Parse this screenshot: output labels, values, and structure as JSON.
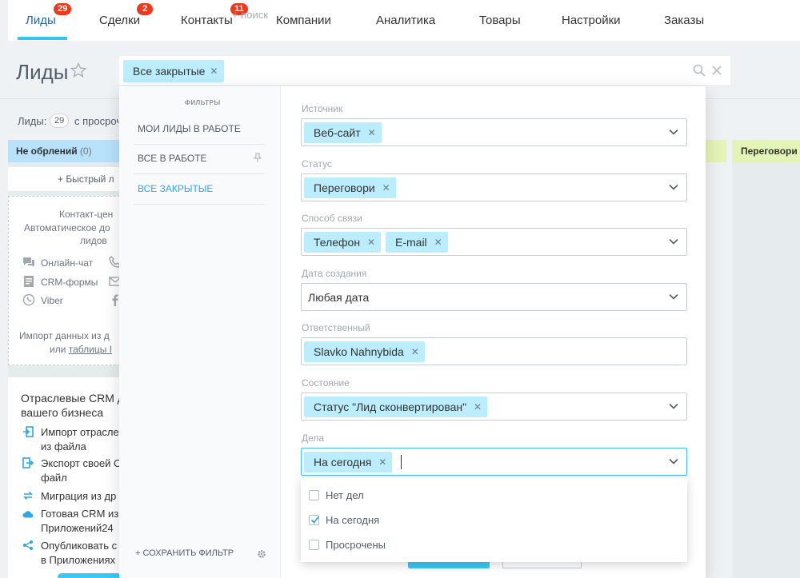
{
  "nav": {
    "items": [
      {
        "label": "Лиды",
        "badge": "29"
      },
      {
        "label": "Сделки",
        "badge": "2"
      },
      {
        "label": "Контакты",
        "badge": "11"
      },
      {
        "label": "Компании"
      },
      {
        "label": "Аналитика"
      },
      {
        "label": "Товары"
      },
      {
        "label": "Настройки"
      },
      {
        "label": "Заказы"
      }
    ]
  },
  "header": {
    "title": "Лиды"
  },
  "search": {
    "chip_label": "Все закрытые",
    "placeholder": "+ поиск"
  },
  "board": {
    "leads_label": "Лиды:",
    "leads_count": "29",
    "leads_suffix": "с просроч",
    "stage_left": "Не обрлений",
    "stage_left_count": "(0)",
    "stage_right": "Переговори",
    "quick_add": "+ Быстрый л",
    "promo": {
      "line1": "Контакт-цен",
      "line2": "Автоматическое до",
      "line3": "лидов",
      "chat": "Онлайн-чат",
      "forms": "CRM-формы",
      "viber": "Viber",
      "import1": "Импорт данных из д",
      "import2_pre": "или ",
      "import2_link": "таблицы I"
    },
    "industry": {
      "title1": "Отраслевые CRM д",
      "title2": "вашего бизнеса",
      "items": [
        [
          "Импорт отрасле",
          "из файла"
        ],
        [
          "Экспорт своей С",
          "файл"
        ],
        [
          "Миграция из др"
        ],
        [
          "Готовая CRM из",
          "Приложений24"
        ],
        [
          "Опубликовать с",
          "в Приложениях"
        ]
      ]
    }
  },
  "filter": {
    "sidebar_heading": "ФИЛЬТРЫ",
    "presets": [
      "МОИ ЛИДЫ В РАБОТЕ",
      "ВСЕ В РАБОТЕ",
      "ВСЕ ЗАКРЫТЫЕ"
    ],
    "save_label": "+ СОХРАНИТЬ ФИЛЬТР",
    "fields": {
      "source": {
        "label": "Источник",
        "tags": [
          "Веб-сайт"
        ]
      },
      "status": {
        "label": "Статус",
        "tags": [
          "Переговори"
        ]
      },
      "contact_method": {
        "label": "Способ связи",
        "tags": [
          "Телефон",
          "E-mail"
        ]
      },
      "created": {
        "label": "Дата создания",
        "value": "Любая дата"
      },
      "responsible": {
        "label": "Ответственный",
        "tags": [
          "Slavko Nahnybida"
        ]
      },
      "state": {
        "label": "Состояние",
        "tags": [
          "Статус \"Лид сконвертирован\""
        ]
      },
      "tasks": {
        "label": "Дела",
        "tags": [
          "На сегодня"
        ]
      }
    },
    "dropdown": {
      "options": [
        {
          "label": "Нет дел",
          "checked": false
        },
        {
          "label": "На сегодня",
          "checked": true
        },
        {
          "label": "Просрочены",
          "checked": false
        }
      ]
    }
  },
  "colors": {
    "accent": "#2fc6f6",
    "badge": "#f0371b",
    "chip": "#bcedfc",
    "link": "#2066b0"
  },
  "icons": {
    "star": "star-icon",
    "search": "search-icon",
    "close": "close-icon",
    "chevron": "chevron-down-icon",
    "pin": "pin-icon",
    "gear": "gear-icon",
    "checkmark": "checkmark-icon"
  }
}
